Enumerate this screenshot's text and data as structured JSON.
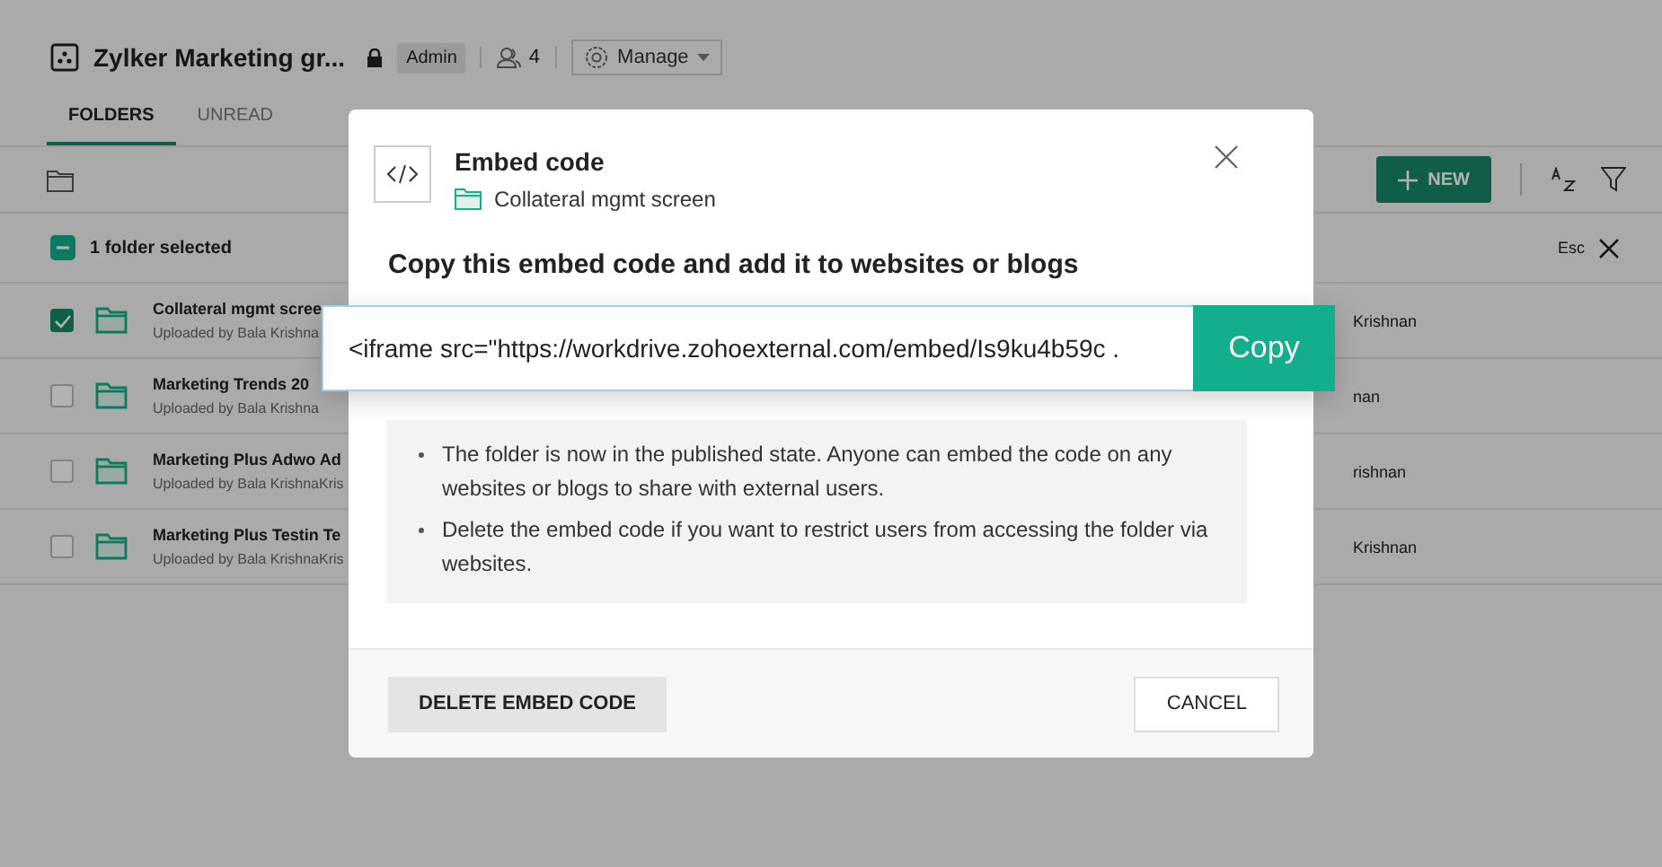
{
  "header": {
    "title": "Zylker Marketing gr...",
    "role": "Admin",
    "member_count": "4",
    "manage_label": "Manage"
  },
  "tabs": [
    {
      "label": "FOLDERS",
      "selected": true
    },
    {
      "label": "UNREAD",
      "selected": false
    }
  ],
  "toolbar": {
    "new_label": "NEW"
  },
  "selection_bar": {
    "label": "1 folder selected",
    "esc_label": "Esc",
    "checked": true
  },
  "rows": [
    {
      "name": "Collateral mgmt scree",
      "uploaded": "Uploaded by Bala Krishna",
      "owner": "Krishnan",
      "checked": true
    },
    {
      "name": "Marketing Trends 20",
      "uploaded": "Uploaded by Bala Krishna",
      "owner": "nan",
      "checked": false
    },
    {
      "name": "Marketing Plus Adwo Ad",
      "uploaded": "Uploaded by Bala KrishnaKris",
      "owner": "rishnan",
      "checked": false
    },
    {
      "name": "Marketing Plus Testin Te",
      "uploaded": "Uploaded by Bala KrishnaKris",
      "owner": "Krishnan",
      "checked": false
    }
  ],
  "dialog": {
    "title": "Embed code",
    "folder": "Collateral mgmt screen",
    "heading": "Copy this embed code and add it to websites or blogs",
    "embed_code": "<iframe src=\"https://workdrive.zohoexternal.com/embed/Is9ku4b59c .",
    "copy_label": "Copy",
    "notes": [
      "The folder is now in the published state. Anyone can embed the code on any websites or blogs to share with external users.",
      "Delete the embed code if you want to restrict users from accessing the folder via websites."
    ],
    "delete_label": "DELETE EMBED CODE",
    "cancel_label": "CANCEL"
  }
}
